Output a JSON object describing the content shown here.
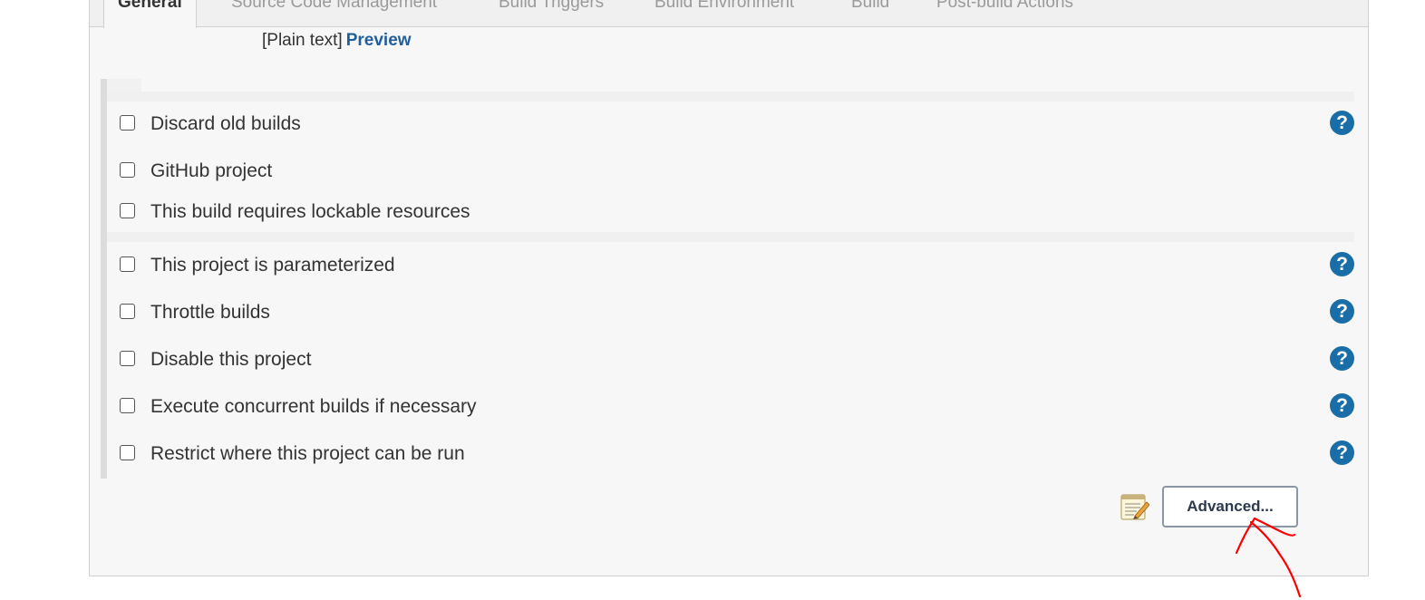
{
  "tabs": [
    {
      "label": "General",
      "active": true
    },
    {
      "label": "Source Code Management",
      "active": false
    },
    {
      "label": "Build Triggers",
      "active": false
    },
    {
      "label": "Build Environment",
      "active": false
    },
    {
      "label": "Build",
      "active": false
    },
    {
      "label": "Post-build Actions",
      "active": false
    }
  ],
  "description": {
    "plain_text_label": "[Plain text]",
    "preview_link": "Preview"
  },
  "options": [
    {
      "label": "Discard old builds",
      "checked": false,
      "help": true
    },
    {
      "label": "GitHub project",
      "checked": false,
      "help": false
    },
    {
      "label": "This build requires lockable resources",
      "checked": false,
      "help": false
    },
    {
      "label": "This project is parameterized",
      "checked": false,
      "help": true
    },
    {
      "label": "Throttle builds",
      "checked": false,
      "help": true
    },
    {
      "label": "Disable this project",
      "checked": false,
      "help": true
    },
    {
      "label": "Execute concurrent builds if necessary",
      "checked": false,
      "help": true
    },
    {
      "label": "Restrict where this project can be run",
      "checked": false,
      "help": true
    }
  ],
  "help_glyph": "?",
  "advanced_button_label": "Advanced...",
  "icons": {
    "help": "help-icon",
    "notepad": "notepad-icon"
  },
  "colors": {
    "link": "#1f5f9e",
    "help": "#1a6ea8",
    "annotation": "#ff0000"
  }
}
